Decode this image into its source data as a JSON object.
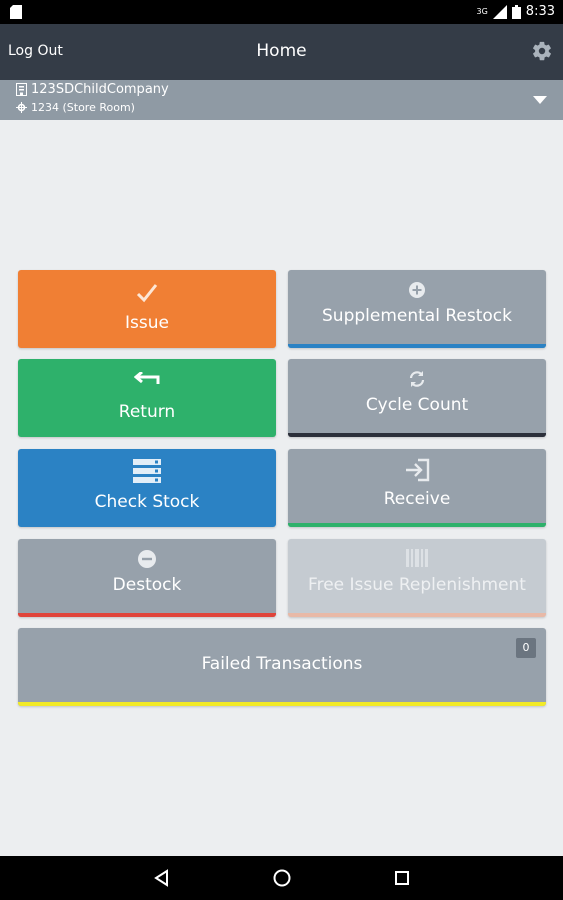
{
  "status_bar": {
    "network": "3G",
    "time": "8:33"
  },
  "header": {
    "logout_label": "Log Out",
    "title": "Home"
  },
  "location": {
    "company": "123SDChildCompany",
    "store": "1234 (Store Room)"
  },
  "tiles": {
    "issue": {
      "label": "Issue",
      "color": "#f07f34"
    },
    "supplemental_restock": {
      "label": "Supplemental Restock",
      "accent": "#2b82c4"
    },
    "return": {
      "label": "Return",
      "color": "#2eb16b"
    },
    "cycle_count": {
      "label": "Cycle Count",
      "accent": "#2b2f3a"
    },
    "check_stock": {
      "label": "Check Stock",
      "color": "#2b82c4"
    },
    "receive": {
      "label": "Receive",
      "accent": "#2eb16b"
    },
    "destock": {
      "label": "Destock",
      "accent": "#e0443a"
    },
    "free_issue_replenishment": {
      "label": "Free Issue Replenishment",
      "accent": "#e8b9a7"
    },
    "failed_transactions": {
      "label": "Failed Transactions",
      "count": "0",
      "accent": "#f2ea27"
    }
  }
}
